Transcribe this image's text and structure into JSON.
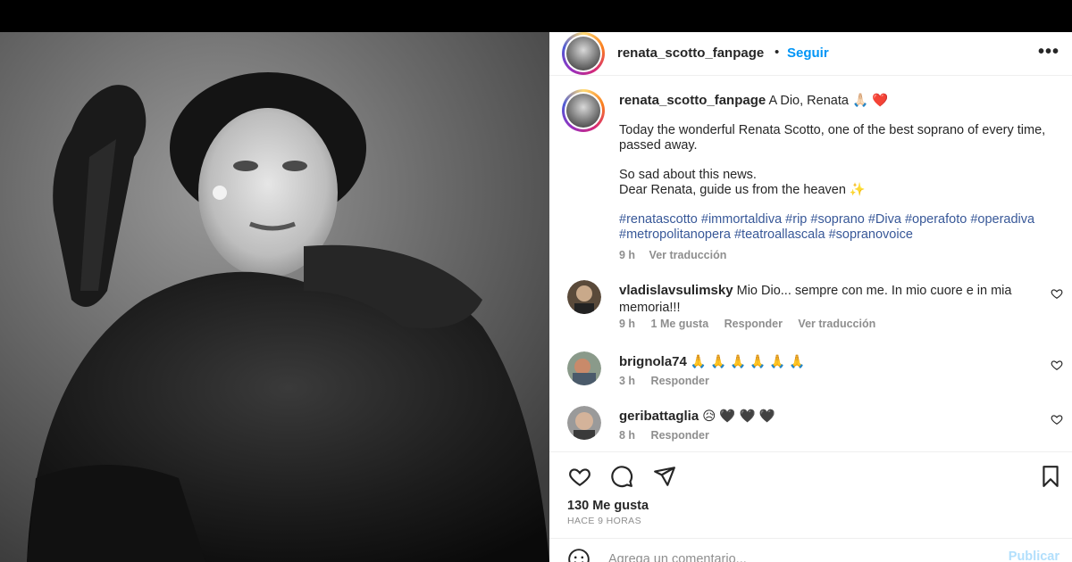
{
  "post_header": {
    "username": "renata_scotto_fanpage",
    "separator": "•",
    "follow_label": "Seguir",
    "more_label": "•••"
  },
  "caption": {
    "username": "renata_scotto_fanpage",
    "title": "A Dio, Renata 🙏🏻 ❤️",
    "paragraph1": "Today the wonderful Renata Scotto, one of the best soprano of every time, passed away.",
    "paragraph2_line1": "So sad about this news.",
    "paragraph2_line2": "Dear Renata, guide us from the heaven ✨",
    "hashtags": "#renatascotto #immortaldiva #rip #soprano #Diva #operafoto #operadiva #metropolitanopera #teatroallascala #sopranovoice",
    "time": "9 h",
    "translate": "Ver traducción"
  },
  "comments": [
    {
      "username": "vladislavsulimsky",
      "text": "Mio Dio... sempre con me. In mio cuore e in mia memoria!!!",
      "time": "9 h",
      "likes": "1 Me gusta",
      "reply": "Responder",
      "translate": "Ver traducción"
    },
    {
      "username": "brignola74",
      "text": "🙏 🙏 🙏 🙏 🙏 🙏",
      "time": "3 h",
      "reply": "Responder"
    },
    {
      "username": "geribattaglia",
      "text": "😥 🖤 🖤 🖤",
      "time": "8 h",
      "reply": "Responder"
    }
  ],
  "footer": {
    "likes": "130 Me gusta",
    "ago": "HACE 9 HORAS",
    "comment_placeholder": "Agrega un comentario...",
    "publish_label": "Publicar"
  },
  "colors": {
    "link_blue": "#0095f6",
    "hashtag_blue": "#385898",
    "muted_gray": "#8e8e8e",
    "publish_disabled": "#b2dffc"
  }
}
